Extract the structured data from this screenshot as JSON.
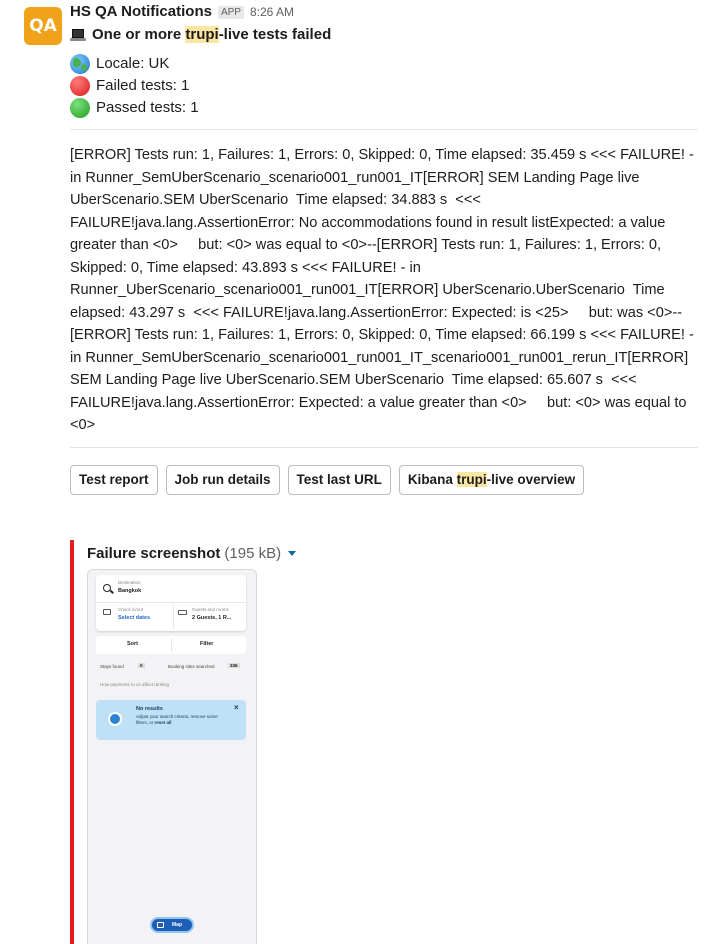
{
  "sender": {
    "avatar_text": "QA",
    "name": "HS QA Notifications",
    "badge": "APP",
    "time": "8:26 AM"
  },
  "title": {
    "icon": "laptop-icon",
    "prefix": "One or more ",
    "highlight": "trupi",
    "suffix": "-live tests failed"
  },
  "status": {
    "locale": "Locale: UK",
    "failed": "Failed tests: 1",
    "passed": "Passed tests: 1"
  },
  "error_text": "[ERROR] Tests run: 1, Failures: 1, Errors: 0, Skipped: 0, Time elapsed: 35.459 s <<< FAILURE! - in Runner_SemUberScenario_scenario001_run001_IT[ERROR] SEM Landing Page live UberScenario.SEM UberScenario  Time elapsed: 34.883 s  <<< FAILURE!java.lang.AssertionError: No accommodations found in result listExpected: a value greater than <0>     but: <0> was equal to <0>--[ERROR] Tests run: 1, Failures: 1, Errors: 0, Skipped: 0, Time elapsed: 43.893 s <<< FAILURE! - in Runner_UberScenario_scenario001_run001_IT[ERROR] UberScenario.UberScenario  Time elapsed: 43.297 s  <<< FAILURE!java.lang.AssertionError: Expected: is <25>     but: was <0>--[ERROR] Tests run: 1, Failures: 1, Errors: 0, Skipped: 0, Time elapsed: 66.199 s <<< FAILURE! - in Runner_SemUberScenario_scenario001_run001_IT_scenario001_run001_rerun_IT[ERROR] SEM Landing Page live UberScenario.SEM UberScenario  Time elapsed: 65.607 s  <<< FAILURE!java.lang.AssertionError: Expected: a value greater than <0>     but: <0> was equal to <0>",
  "buttons": {
    "test_report": "Test report",
    "job_run": "Job run details",
    "last_url": "Test last URL",
    "kibana_prefix": "Kibana ",
    "kibana_highlight": "trupi",
    "kibana_suffix": "-live overview"
  },
  "attachment": {
    "title": "Failure screenshot",
    "size": "(195 kB)",
    "border_color": "#e01e1e"
  },
  "screenshot": {
    "destination_label": "Destination",
    "destination_value": "Bangkok",
    "checkin_label": "Check in/out",
    "checkin_value": "Select dates",
    "guests_label": "Guests and rooms",
    "guests_value": "2 Guests, 1 R...",
    "sort": "Sort",
    "filter": "Filter",
    "stays_found": "Stays found",
    "stays_count": "0",
    "booking_sites": "Booking sites searched",
    "booking_count": "336",
    "payments_note": "How payments to us affect ranking",
    "no_results_title": "No results",
    "no_results_text": "Adjust your search criteria, remove some filters, or",
    "reset": "reset all",
    "map": "Map"
  },
  "colors": {
    "avatar": "#f0a21b",
    "highlight": "#fbe6a2",
    "failure_bar": "#e01e1e",
    "link": "#1264a3"
  }
}
